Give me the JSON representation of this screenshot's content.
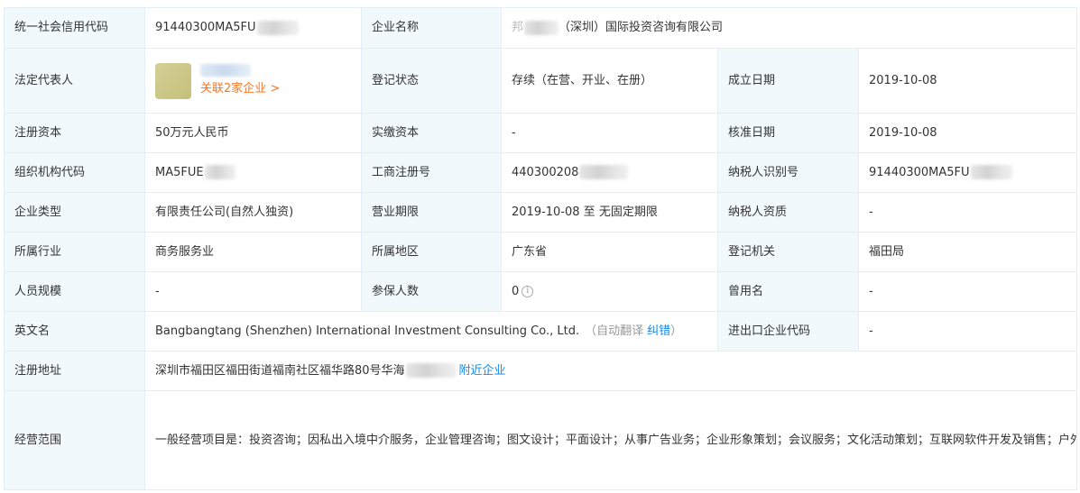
{
  "rows": {
    "credit_code": {
      "label": "统一社会信用代码",
      "value": "91440300MA5FU"
    },
    "company_name": {
      "label": "企业名称",
      "prefix": "邦",
      "suffix": "（深圳）国际投资咨询有限公司"
    },
    "legal_rep": {
      "label": "法定代表人",
      "related_link": "关联2家企业 >"
    },
    "reg_status": {
      "label": "登记状态",
      "value": "存续（在营、开业、在册）"
    },
    "est_date": {
      "label": "成立日期",
      "value": "2019-10-08"
    },
    "reg_capital": {
      "label": "注册资本",
      "value": "50万元人民币"
    },
    "paid_capital": {
      "label": "实缴资本",
      "value": "-"
    },
    "approve_date": {
      "label": "核准日期",
      "value": "2019-10-08"
    },
    "org_code": {
      "label": "组织机构代码",
      "value": "MA5FUE"
    },
    "biz_reg_no": {
      "label": "工商注册号",
      "value": "440300208"
    },
    "taxpayer_id": {
      "label": "纳税人识别号",
      "value": "91440300MA5FU"
    },
    "company_type": {
      "label": "企业类型",
      "value": "有限责任公司(自然人独资)"
    },
    "biz_term": {
      "label": "营业期限",
      "value": "2019-10-08 至 无固定期限"
    },
    "taxpayer_qual": {
      "label": "纳税人资质",
      "value": "-"
    },
    "industry": {
      "label": "所属行业",
      "value": "商务服务业"
    },
    "region": {
      "label": "所属地区",
      "value": "广东省"
    },
    "reg_authority": {
      "label": "登记机关",
      "value": "福田局"
    },
    "staff_size": {
      "label": "人员规模",
      "value": "-"
    },
    "insured": {
      "label": "参保人数",
      "value": "0",
      "icon": "info-circle-icon"
    },
    "former_name": {
      "label": "曾用名",
      "value": "-"
    },
    "english_name": {
      "label": "英文名",
      "value": "Bangbangtang (Shenzhen) International Investment Consulting Co., Ltd.",
      "auto_translate": "（自动翻译",
      "correct_link": "纠错",
      "close_paren": "）"
    },
    "import_export": {
      "label": "进出口企业代码",
      "value": "-"
    },
    "reg_address": {
      "label": "注册地址",
      "value": "深圳市福田区福田街道福南社区福华路80号华海",
      "nearby_link": "附近企业"
    },
    "biz_scope": {
      "label": "经营范围",
      "value": "一般经营项目是：投资咨询；因私出入境中介服务，企业管理咨询；图文设计；平面设计；从事广告业务；企业形象策划；会议服务；文化活动策划；互联网软件开发及销售；户外运动用品、日用品、初级农产品的销售；互联网技术研发、技术咨询、技术转让、技术服务；计算机软硬件、多媒体技术开发、技术服务、技术咨询与销售；商务信息咨询；经济信息咨询；国内贸易；货物及技术进出口。（法律、行政法规、国务院决定禁止的项目除外，限制的项目须取得许可后方可经营），许可经营项目是：自费出国留学中介服务，国内旅游业务；入境旅游业务；出境旅游业务，预包装食品、保健食品、营养补充食品的销售。"
    }
  }
}
